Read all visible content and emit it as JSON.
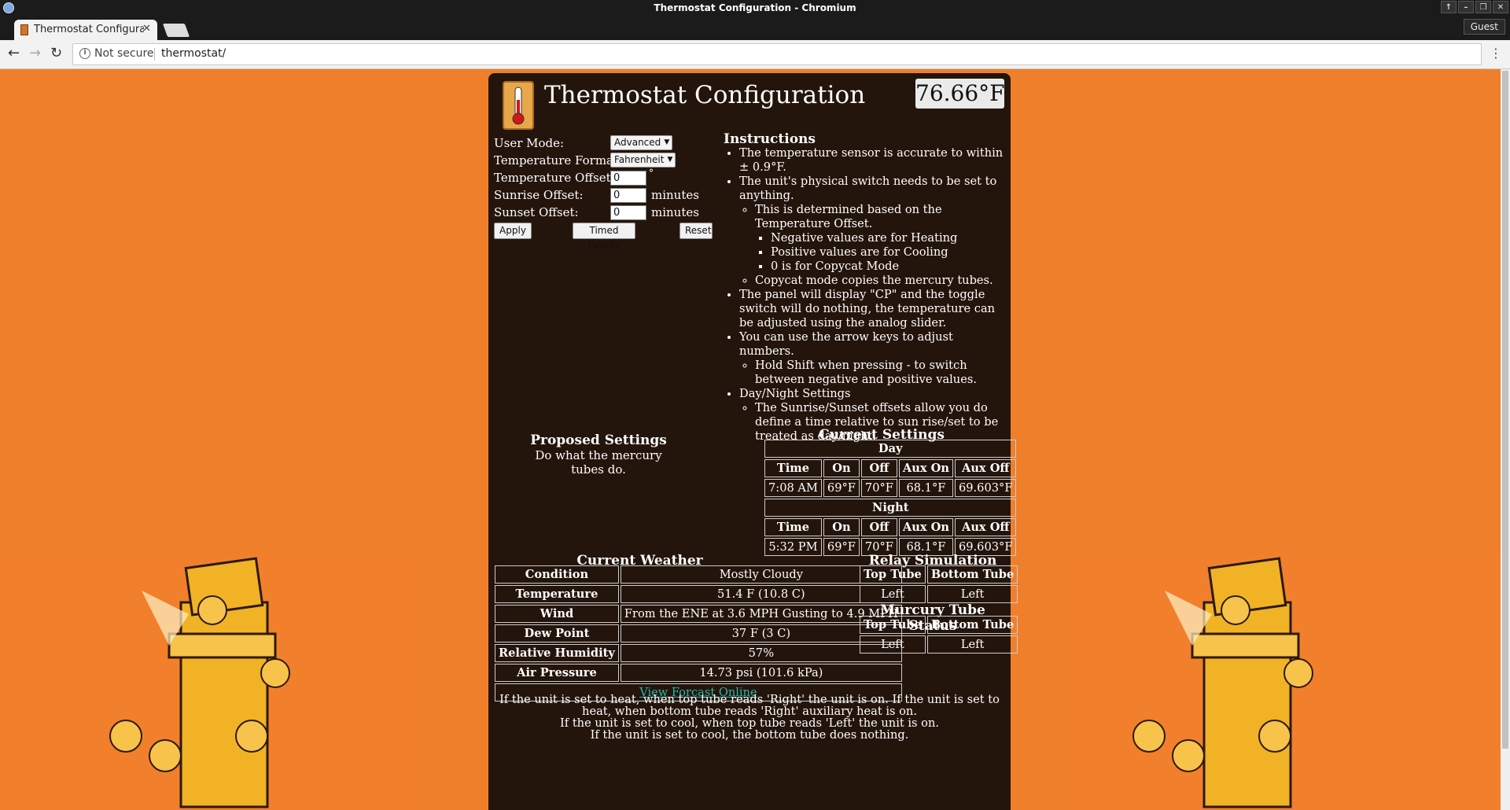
{
  "window": {
    "title": "Thermostat Configuration - Chromium"
  },
  "browser": {
    "tab_title": "Thermostat Configura",
    "security": "Not secure",
    "url": "thermostat/",
    "profile": "Guest"
  },
  "header": {
    "title": "Thermostat Configuration",
    "temperature": "76.66°F"
  },
  "form": {
    "user_mode_label": "User Mode:",
    "user_mode_value": "Advanced",
    "temp_format_label": "Temperature Format:",
    "temp_format_value": "Fahrenheit",
    "temp_offset_label": "Temperature Offset:",
    "temp_offset_value": "0",
    "temp_offset_unit": "°",
    "sunrise_label": "Sunrise Offset:",
    "sunrise_value": "0",
    "sunset_label": "Sunset Offset:",
    "sunset_value": "0",
    "minutes_unit": "minutes",
    "apply": "Apply",
    "timed_events": "Timed Events",
    "reset": "Reset"
  },
  "instructions": {
    "title": "Instructions",
    "i1": "The temperature sensor is accurate to within ± 0.9°F.",
    "i2": "The unit's physical switch needs to be set to anything.",
    "i2a": "This is determined based on the Temperature Offset.",
    "i2a1": "Negative values are for Heating",
    "i2a2": "Positive values are for Cooling",
    "i2a3": "0 is for Copycat Mode",
    "i2b": "Copycat mode copies the mercury tubes.",
    "i3": "The panel will display \"CP\" and the toggle switch will do nothing, the temperature can be adjusted using the analog slider.",
    "i4": "You can use the arrow keys to adjust numbers.",
    "i4a": "Hold Shift when pressing  -  to switch between negative and positive values.",
    "i5": "Day/Night Settings",
    "i5a": "The Sunrise/Sunset offsets allow you do define a time relative to sun rise/set to be treated as day/night."
  },
  "proposed": {
    "title": "Proposed Settings",
    "text": "Do what the mercury tubes do."
  },
  "current_settings": {
    "title": "Current Settings",
    "headers": [
      "Time",
      "On",
      "Off",
      "Aux On",
      "Aux Off"
    ],
    "day_label": "Day",
    "day": [
      "7:08 AM",
      "69°F",
      "70°F",
      "68.1°F",
      "69.603°F"
    ],
    "night_label": "Night",
    "night": [
      "5:32 PM",
      "69°F",
      "70°F",
      "68.1°F",
      "69.603°F"
    ]
  },
  "weather": {
    "title": "Current Weather",
    "rows": [
      {
        "label": "Condition",
        "value": "Mostly Cloudy"
      },
      {
        "label": "Temperature",
        "value": "51.4 F (10.8 C)"
      },
      {
        "label": "Wind",
        "value": "From the ENE at 3.6 MPH Gusting to 4.9 MPH"
      },
      {
        "label": "Dew Point",
        "value": "37 F (3 C)"
      },
      {
        "label": "Relative Humidity",
        "value": "57%"
      },
      {
        "label": "Air Pressure",
        "value": "14.73 psi (101.6 kPa)"
      }
    ],
    "link": "View Forcast Online"
  },
  "relay": {
    "title": "Relay Simulation",
    "headers": [
      "Top Tube",
      "Bottom Tube"
    ],
    "values": [
      "Left",
      "Left"
    ]
  },
  "mercury": {
    "title": "Murcury Tube Status",
    "headers": [
      "Top Tube",
      "Bottom Tube"
    ],
    "values": [
      "Left",
      "Left"
    ]
  },
  "footer": {
    "l1": "If the unit is set to heat, when top tube reads 'Right' the unit is on. If the unit is set to heat, when bottom tube reads 'Right' auxiliary heat is on.",
    "l2": "If the unit is set to cool, when top tube reads 'Left' the unit is on.",
    "l3": "If the unit is set to cool, the bottom tube does nothing."
  }
}
